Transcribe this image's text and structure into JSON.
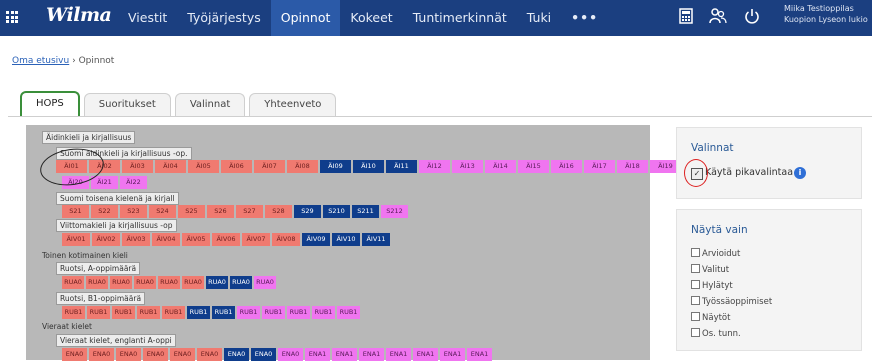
{
  "app": {
    "logo": "Wilma"
  },
  "nav": [
    {
      "label": "Viestit",
      "active": false
    },
    {
      "label": "Työjärjestys",
      "active": false
    },
    {
      "label": "Opinnot",
      "active": true
    },
    {
      "label": "Kokeet",
      "active": false
    },
    {
      "label": "Tuntimerkinnät",
      "active": false
    },
    {
      "label": "Tuki",
      "active": false
    },
    {
      "label": "•••",
      "active": false
    }
  ],
  "top_icons": [
    "calculator-icon",
    "people-icon",
    "power-icon"
  ],
  "user": {
    "name": "Miika Testioppilas",
    "school": "Kuopion Lyseon lukio"
  },
  "breadcrumb": {
    "home": "Oma etusivu",
    "separator": "›",
    "current": "Opinnot"
  },
  "tabs": [
    {
      "label": "HOPS",
      "active": true
    },
    {
      "label": "Suoritukset",
      "active": false
    },
    {
      "label": "Valinnat",
      "active": false
    },
    {
      "label": "Yhteenveto",
      "active": false
    }
  ],
  "hops": {
    "groups": [
      {
        "label": "Äidinkieli ja kirjallisuus"
      },
      {
        "label": "Suomi äidinkieli ja kirjallisuus -op.",
        "courses": [
          [
            "ÄI01",
            "r"
          ],
          [
            "ÄI02",
            "r"
          ],
          [
            "ÄI03",
            "r"
          ],
          [
            "ÄI04",
            "r"
          ],
          [
            "ÄI05",
            "r"
          ],
          [
            "ÄI06",
            "r"
          ],
          [
            "ÄI07",
            "r"
          ],
          [
            "ÄI08",
            "r"
          ],
          [
            "ÄI09",
            "b"
          ],
          [
            "ÄI10",
            "b"
          ],
          [
            "ÄI11",
            "b"
          ],
          [
            "ÄI12",
            "p"
          ],
          [
            "ÄI13",
            "p"
          ],
          [
            "ÄI14",
            "p"
          ],
          [
            "ÄI15",
            "p"
          ],
          [
            "ÄI16",
            "p"
          ],
          [
            "ÄI17",
            "p"
          ],
          [
            "ÄI18",
            "p"
          ],
          [
            "ÄI19",
            "p"
          ]
        ],
        "courses2": [
          [
            "ÄI20",
            "p"
          ],
          [
            "ÄI21",
            "p"
          ],
          [
            "ÄI22",
            "p"
          ]
        ]
      },
      {
        "label": "Suomi toisena kielenä ja kirjall",
        "courses": [
          [
            "S21",
            "r"
          ],
          [
            "S22",
            "r"
          ],
          [
            "S23",
            "r"
          ],
          [
            "S24",
            "r"
          ],
          [
            "S25",
            "r"
          ],
          [
            "S26",
            "r"
          ],
          [
            "S27",
            "r"
          ],
          [
            "S28",
            "r"
          ],
          [
            "S29",
            "b"
          ],
          [
            "S210",
            "b"
          ],
          [
            "S211",
            "b"
          ],
          [
            "S212",
            "p"
          ]
        ]
      },
      {
        "label": "Viittomakieli ja kirjallisuus -op",
        "courses": [
          [
            "ÄIV01",
            "r"
          ],
          [
            "ÄIV02",
            "r"
          ],
          [
            "ÄIV03",
            "r"
          ],
          [
            "ÄIV04",
            "r"
          ],
          [
            "ÄIV05",
            "r"
          ],
          [
            "ÄIV06",
            "r"
          ],
          [
            "ÄIV07",
            "r"
          ],
          [
            "ÄIV08",
            "r"
          ],
          [
            "ÄIV09",
            "b"
          ],
          [
            "ÄIV10",
            "b"
          ],
          [
            "ÄIV11",
            "b"
          ]
        ]
      },
      {
        "label": "Toinen kotimainen kieli"
      },
      {
        "label": "Ruotsi, A-oppimäärä",
        "courses": [
          [
            "RUA0",
            "r"
          ],
          [
            "RUA0",
            "r"
          ],
          [
            "RUA0",
            "r"
          ],
          [
            "RUA0",
            "r"
          ],
          [
            "RUA0",
            "r"
          ],
          [
            "RUA0",
            "r"
          ],
          [
            "RUA0",
            "b"
          ],
          [
            "RUA0",
            "b"
          ],
          [
            "RUA0",
            "p"
          ]
        ]
      },
      {
        "label": "Ruotsi, B1-oppimäärä",
        "courses": [
          [
            "RUB1",
            "r"
          ],
          [
            "RUB1",
            "r"
          ],
          [
            "RUB1",
            "r"
          ],
          [
            "RUB1",
            "r"
          ],
          [
            "RUB1",
            "r"
          ],
          [
            "RUB1",
            "b"
          ],
          [
            "RUB1",
            "b"
          ],
          [
            "RUB1",
            "p"
          ],
          [
            "RUB1",
            "p"
          ],
          [
            "RUB1",
            "p"
          ],
          [
            "RUB1",
            "p"
          ],
          [
            "RUB1",
            "p"
          ]
        ]
      },
      {
        "label": "Vieraat kielet"
      },
      {
        "label": "Vieraat kielet, englanti A-oppi",
        "courses": [
          [
            "ENA0",
            "r"
          ],
          [
            "ENA0",
            "r"
          ],
          [
            "ENA0",
            "r"
          ],
          [
            "ENA0",
            "r"
          ],
          [
            "ENA0",
            "r"
          ],
          [
            "ENA0",
            "r"
          ],
          [
            "ENA0",
            "b"
          ],
          [
            "ENA0",
            "b"
          ],
          [
            "ENA0",
            "p"
          ],
          [
            "ENA1",
            "p"
          ],
          [
            "ENA1",
            "p"
          ],
          [
            "ENA1",
            "p"
          ],
          [
            "ENA1",
            "p"
          ],
          [
            "ENA1",
            "p"
          ],
          [
            "ENA1",
            "p"
          ],
          [
            "ENA1",
            "p"
          ]
        ]
      }
    ]
  },
  "valinnat": {
    "title": "Valinnat",
    "quick_select_label": "Käytä pikavalintaa",
    "quick_select_checked": true
  },
  "nayta_vain": {
    "title": "Näytä vain",
    "options": [
      "Arvioidut",
      "Valitut",
      "Hylätyt",
      "Työssäoppimiset",
      "Näytöt",
      "Os. tunn."
    ]
  }
}
